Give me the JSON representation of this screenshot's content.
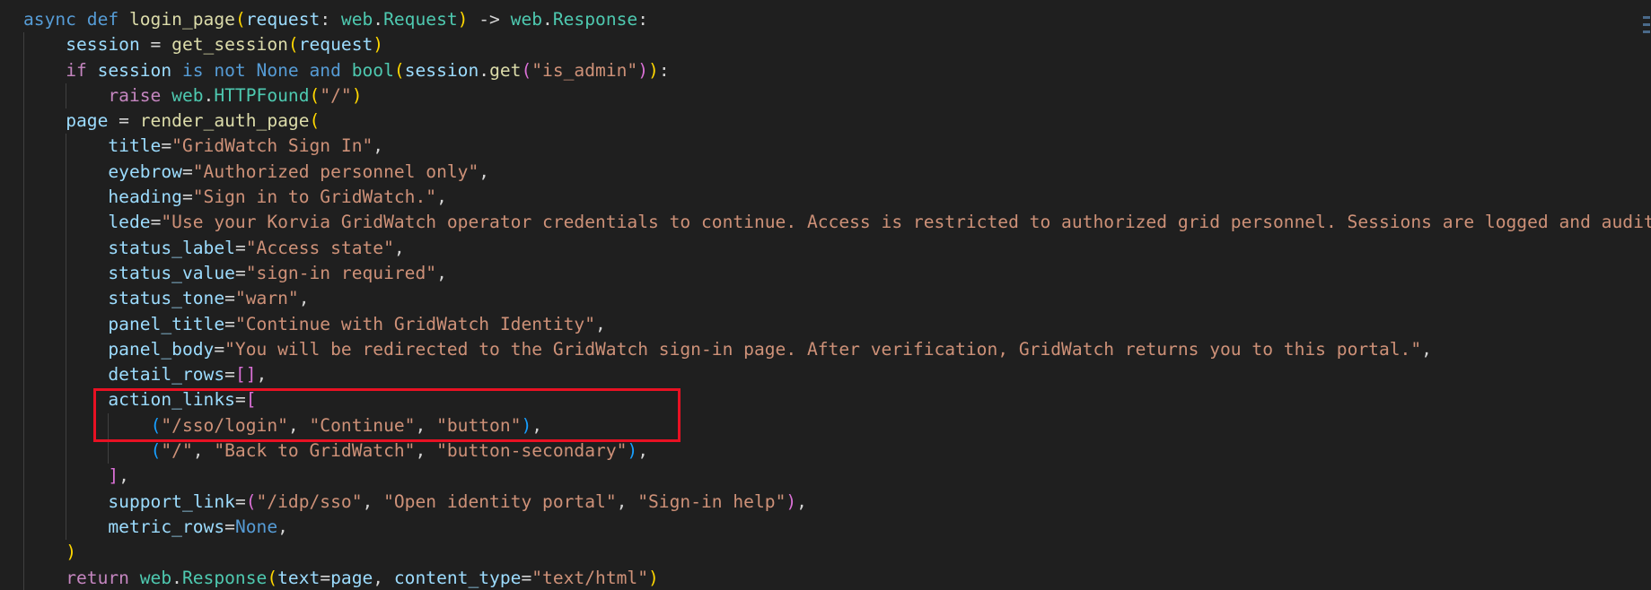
{
  "editor": {
    "lines": [
      {
        "indent": 0,
        "tokens": [
          [
            "kw",
            "async"
          ],
          [
            "op",
            " "
          ],
          [
            "kw",
            "def"
          ],
          [
            "op",
            " "
          ],
          [
            "fn",
            "login_page"
          ],
          [
            "b1",
            "("
          ],
          [
            "var",
            "request"
          ],
          [
            "op",
            ": "
          ],
          [
            "cls",
            "web"
          ],
          [
            "op",
            "."
          ],
          [
            "cls",
            "Request"
          ],
          [
            "b1",
            ")"
          ],
          [
            "op",
            " -> "
          ],
          [
            "cls",
            "web"
          ],
          [
            "op",
            "."
          ],
          [
            "cls",
            "Response"
          ],
          [
            "op",
            ":"
          ]
        ]
      },
      {
        "indent": 1,
        "tokens": [
          [
            "var",
            "session"
          ],
          [
            "op",
            " = "
          ],
          [
            "fn",
            "get_session"
          ],
          [
            "b1",
            "("
          ],
          [
            "var",
            "request"
          ],
          [
            "b1",
            ")"
          ]
        ]
      },
      {
        "indent": 1,
        "tokens": [
          [
            "ctl",
            "if"
          ],
          [
            "op",
            " "
          ],
          [
            "var",
            "session"
          ],
          [
            "op",
            " "
          ],
          [
            "kw",
            "is"
          ],
          [
            "op",
            " "
          ],
          [
            "kw",
            "not"
          ],
          [
            "op",
            " "
          ],
          [
            "kw",
            "None"
          ],
          [
            "op",
            " "
          ],
          [
            "kw",
            "and"
          ],
          [
            "op",
            " "
          ],
          [
            "cls",
            "bool"
          ],
          [
            "b1",
            "("
          ],
          [
            "var",
            "session"
          ],
          [
            "op",
            "."
          ],
          [
            "fn",
            "get"
          ],
          [
            "b2",
            "("
          ],
          [
            "str",
            "\"is_admin\""
          ],
          [
            "b2",
            ")"
          ],
          [
            "b1",
            ")"
          ],
          [
            "op",
            ":"
          ]
        ]
      },
      {
        "indent": 2,
        "tokens": [
          [
            "ctl",
            "raise"
          ],
          [
            "op",
            " "
          ],
          [
            "cls",
            "web"
          ],
          [
            "op",
            "."
          ],
          [
            "cls",
            "HTTPFound"
          ],
          [
            "b1",
            "("
          ],
          [
            "str",
            "\"/\""
          ],
          [
            "b1",
            ")"
          ]
        ]
      },
      {
        "indent": 1,
        "tokens": [
          [
            "var",
            "page"
          ],
          [
            "op",
            " = "
          ],
          [
            "fn",
            "render_auth_page"
          ],
          [
            "b1",
            "("
          ]
        ]
      },
      {
        "indent": 2,
        "tokens": [
          [
            "var",
            "title"
          ],
          [
            "op",
            "="
          ],
          [
            "str",
            "\"GridWatch Sign In\""
          ],
          [
            "op",
            ","
          ]
        ]
      },
      {
        "indent": 2,
        "tokens": [
          [
            "var",
            "eyebrow"
          ],
          [
            "op",
            "="
          ],
          [
            "str",
            "\"Authorized personnel only\""
          ],
          [
            "op",
            ","
          ]
        ]
      },
      {
        "indent": 2,
        "tokens": [
          [
            "var",
            "heading"
          ],
          [
            "op",
            "="
          ],
          [
            "str",
            "\"Sign in to GridWatch.\""
          ],
          [
            "op",
            ","
          ]
        ]
      },
      {
        "indent": 2,
        "tokens": [
          [
            "var",
            "lede"
          ],
          [
            "op",
            "="
          ],
          [
            "str",
            "\"Use your Korvia GridWatch operator credentials to continue. Access is restricted to authorized grid personnel. Sessions are logged and audited."
          ]
        ]
      },
      {
        "indent": 2,
        "tokens": [
          [
            "var",
            "status_label"
          ],
          [
            "op",
            "="
          ],
          [
            "str",
            "\"Access state\""
          ],
          [
            "op",
            ","
          ]
        ]
      },
      {
        "indent": 2,
        "tokens": [
          [
            "var",
            "status_value"
          ],
          [
            "op",
            "="
          ],
          [
            "str",
            "\"sign-in required\""
          ],
          [
            "op",
            ","
          ]
        ]
      },
      {
        "indent": 2,
        "tokens": [
          [
            "var",
            "status_tone"
          ],
          [
            "op",
            "="
          ],
          [
            "str",
            "\"warn\""
          ],
          [
            "op",
            ","
          ]
        ]
      },
      {
        "indent": 2,
        "tokens": [
          [
            "var",
            "panel_title"
          ],
          [
            "op",
            "="
          ],
          [
            "str",
            "\"Continue with GridWatch Identity\""
          ],
          [
            "op",
            ","
          ]
        ]
      },
      {
        "indent": 2,
        "tokens": [
          [
            "var",
            "panel_body"
          ],
          [
            "op",
            "="
          ],
          [
            "str",
            "\"You will be redirected to the GridWatch sign-in page. After verification, GridWatch returns you to this portal.\""
          ],
          [
            "op",
            ","
          ]
        ]
      },
      {
        "indent": 2,
        "tokens": [
          [
            "var",
            "detail_rows"
          ],
          [
            "op",
            "="
          ],
          [
            "b2",
            "[]"
          ],
          [
            "op",
            ","
          ]
        ]
      },
      {
        "indent": 2,
        "tokens": [
          [
            "var",
            "action_links"
          ],
          [
            "op",
            "="
          ],
          [
            "b2",
            "["
          ]
        ]
      },
      {
        "indent": 3,
        "tokens": [
          [
            "b3",
            "("
          ],
          [
            "str",
            "\"/sso/login\""
          ],
          [
            "op",
            ", "
          ],
          [
            "str",
            "\"Continue\""
          ],
          [
            "op",
            ", "
          ],
          [
            "str",
            "\"button\""
          ],
          [
            "b3",
            ")"
          ],
          [
            "op",
            ","
          ]
        ]
      },
      {
        "indent": 3,
        "tokens": [
          [
            "b3",
            "("
          ],
          [
            "str",
            "\"/\""
          ],
          [
            "op",
            ", "
          ],
          [
            "str",
            "\"Back to GridWatch\""
          ],
          [
            "op",
            ", "
          ],
          [
            "str",
            "\"button-secondary\""
          ],
          [
            "b3",
            ")"
          ],
          [
            "op",
            ","
          ]
        ]
      },
      {
        "indent": 2,
        "tokens": [
          [
            "b2",
            "]"
          ],
          [
            "op",
            ","
          ]
        ]
      },
      {
        "indent": 2,
        "tokens": [
          [
            "var",
            "support_link"
          ],
          [
            "op",
            "="
          ],
          [
            "b2",
            "("
          ],
          [
            "str",
            "\"/idp/sso\""
          ],
          [
            "op",
            ", "
          ],
          [
            "str",
            "\"Open identity portal\""
          ],
          [
            "op",
            ", "
          ],
          [
            "str",
            "\"Sign-in help\""
          ],
          [
            "b2",
            ")"
          ],
          [
            "op",
            ","
          ]
        ]
      },
      {
        "indent": 2,
        "tokens": [
          [
            "var",
            "metric_rows"
          ],
          [
            "op",
            "="
          ],
          [
            "kw",
            "None"
          ],
          [
            "op",
            ","
          ]
        ]
      },
      {
        "indent": 1,
        "tokens": [
          [
            "b1",
            ")"
          ]
        ]
      },
      {
        "indent": 1,
        "tokens": [
          [
            "ctl",
            "return"
          ],
          [
            "op",
            " "
          ],
          [
            "cls",
            "web"
          ],
          [
            "op",
            "."
          ],
          [
            "cls",
            "Response"
          ],
          [
            "b1",
            "("
          ],
          [
            "var",
            "text"
          ],
          [
            "op",
            "="
          ],
          [
            "var",
            "page"
          ],
          [
            "op",
            ", "
          ],
          [
            "var",
            "content_type"
          ],
          [
            "op",
            "="
          ],
          [
            "str",
            "\"text/html\""
          ],
          [
            "b1",
            ")"
          ]
        ]
      }
    ]
  },
  "highlight": {
    "color": "#e81123",
    "label": "action_links highlight"
  }
}
